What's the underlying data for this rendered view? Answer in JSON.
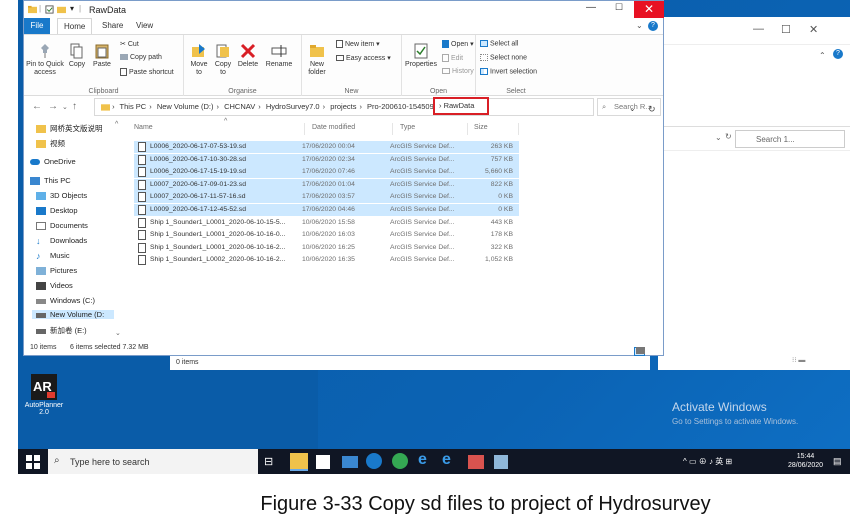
{
  "window": {
    "title": "RawData",
    "tabs": {
      "file": "File",
      "home": "Home",
      "share": "Share",
      "view": "View"
    }
  },
  "ribbon": {
    "clipboard": {
      "label": "Clipboard",
      "pin": "Pin to Quick access",
      "copy": "Copy",
      "paste": "Paste",
      "cut": "Cut",
      "copy_path": "Copy path",
      "paste_shortcut": "Paste shortcut"
    },
    "organise": {
      "label": "Organise",
      "move_to": "Move to",
      "copy_to": "Copy to",
      "delete": "Delete",
      "rename": "Rename"
    },
    "new": {
      "label": "New",
      "new_folder": "New folder",
      "new_item": "New item",
      "easy_access": "Easy access"
    },
    "open": {
      "label": "Open",
      "properties": "Properties",
      "open": "Open",
      "edit": "Edit",
      "history": "History"
    },
    "select": {
      "label": "Select",
      "select_all": "Select all",
      "select_none": "Select none",
      "invert_selection": "Invert selection"
    }
  },
  "address": {
    "crumbs": [
      "This PC",
      "New Volume (D:)",
      "CHCNAV",
      "HydroSurvey7.0",
      "projects",
      "Pro-200610-154509"
    ],
    "current": "RawData",
    "search_placeholder": "Search R..."
  },
  "nav": {
    "items": [
      "网桥英文版说明",
      "视频",
      "OneDrive",
      "This PC",
      "3D Objects",
      "Desktop",
      "Documents",
      "Downloads",
      "Music",
      "Pictures",
      "Videos",
      "Windows (C:)",
      "New Volume (D:",
      "新加卷 (E:)"
    ]
  },
  "columns": {
    "name": "Name",
    "date": "Date modified",
    "type": "Type",
    "size": "Size"
  },
  "files": [
    {
      "name": "L0006_2020-06-17-07-53-19.sd",
      "date": "17/06/2020 00:04",
      "type": "ArcGIS Service Def...",
      "size": "263 KB",
      "selected": true
    },
    {
      "name": "L0006_2020-06-17-10-30-28.sd",
      "date": "17/06/2020 02:34",
      "type": "ArcGIS Service Def...",
      "size": "757 KB",
      "selected": true
    },
    {
      "name": "L0006_2020-06-17-15-19-19.sd",
      "date": "17/06/2020 07:46",
      "type": "ArcGIS Service Def...",
      "size": "5,660 KB",
      "selected": true
    },
    {
      "name": "L0007_2020-06-17-09-01-23.sd",
      "date": "17/06/2020 01:04",
      "type": "ArcGIS Service Def...",
      "size": "822 KB",
      "selected": true
    },
    {
      "name": "L0007_2020-06-17-11-57-16.sd",
      "date": "17/06/2020 03:57",
      "type": "ArcGIS Service Def...",
      "size": "0 KB",
      "selected": true
    },
    {
      "name": "L0009_2020-06-17-12-45-52.sd",
      "date": "17/06/2020 04:46",
      "type": "ArcGIS Service Def...",
      "size": "0 KB",
      "selected": true
    },
    {
      "name": "Ship 1_Sounder1_L0001_2020-06-10-15-5...",
      "date": "10/06/2020 15:58",
      "type": "ArcGIS Service Def...",
      "size": "443 KB",
      "selected": false
    },
    {
      "name": "Ship 1_Sounder1_L0001_2020-06-10-16-0...",
      "date": "10/06/2020 16:03",
      "type": "ArcGIS Service Def...",
      "size": "178 KB",
      "selected": false
    },
    {
      "name": "Ship 1_Sounder1_L0001_2020-06-10-16-2...",
      "date": "10/06/2020 16:25",
      "type": "ArcGIS Service Def...",
      "size": "322 KB",
      "selected": false
    },
    {
      "name": "Ship 1_Sounder1_L0002_2020-06-10-16-2...",
      "date": "10/06/2020 16:35",
      "type": "ArcGIS Service Def...",
      "size": "1,052 KB",
      "selected": false
    }
  ],
  "status": {
    "count": "10 items",
    "selected": "6 items selected  7.32 MB",
    "zero_items": "0 items"
  },
  "bg_window": {
    "search_placeholder": "Search 1..."
  },
  "desktop": {
    "icon_label": "AutoPlanner 2.0",
    "activate_title": "Activate Windows",
    "activate_sub": "Go to Settings to activate Windows."
  },
  "taskbar": {
    "search_placeholder": "Type here to search",
    "tray_text": "英",
    "time": "15:44",
    "date": "28/06/2020"
  },
  "caption": "Figure 3-33 Copy sd files to project of Hydrosurvey",
  "colors": {
    "accent": "#1979ca",
    "highlight": "#d91f26",
    "selection": "#cce8ff",
    "desktop": "#0a5ca8"
  }
}
